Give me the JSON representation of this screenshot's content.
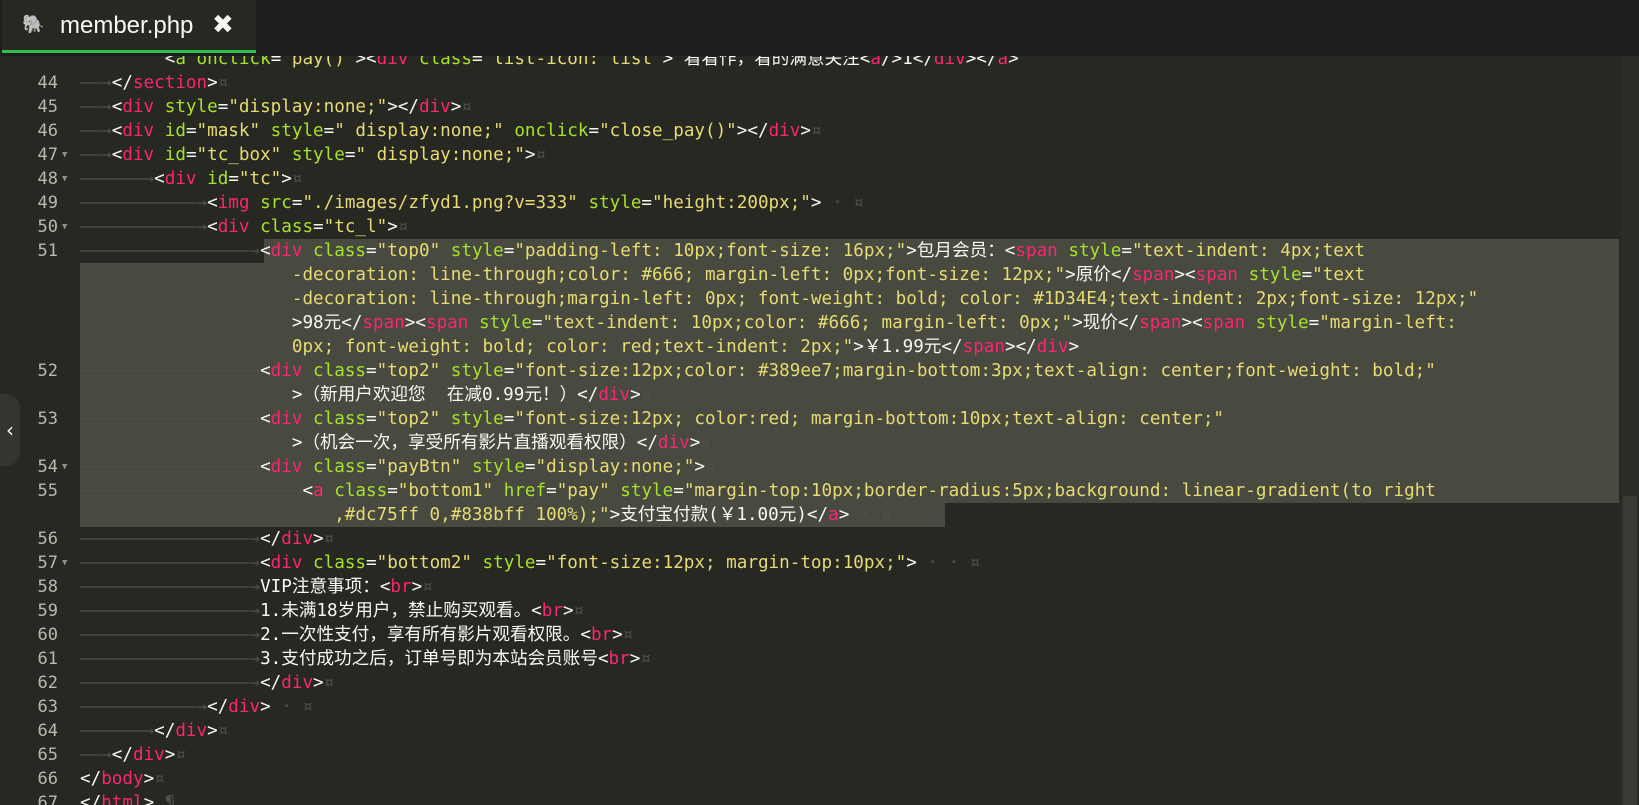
{
  "tab": {
    "title": "member.php",
    "icon": "php-elephant-icon",
    "close_glyph": "✖"
  },
  "lines": [
    {
      "no": "",
      "segs": [
        [
          "ws",
          "        "
        ],
        [
          "t",
          "<"
        ],
        [
          "a",
          "a onclick"
        ],
        [
          "t",
          "="
        ],
        [
          "s",
          "\"pay()\""
        ],
        [
          "t",
          "><"
        ],
        [
          "g",
          "div"
        ],
        [
          "a",
          " class"
        ],
        [
          "t",
          "="
        ],
        [
          "s",
          "\"list-icon: list\""
        ],
        [
          "t",
          "> 看看作，看的满意关注"
        ],
        [
          "t",
          "<"
        ],
        [
          "g",
          "a"
        ],
        [
          "t",
          "/>1"
        ],
        [
          "t",
          "</"
        ],
        [
          "g",
          "div"
        ],
        [
          "t",
          "></"
        ],
        [
          "g",
          "a"
        ],
        [
          "t",
          ">"
        ]
      ]
    },
    {
      "no": "44",
      "segs": [
        [
          "ws",
          "——→"
        ],
        [
          "t",
          "</"
        ],
        [
          "g",
          "section"
        ],
        [
          "t",
          ">"
        ],
        [
          "ws",
          "¤"
        ]
      ]
    },
    {
      "no": "45",
      "segs": [
        [
          "ws",
          "——→"
        ],
        [
          "t",
          "<"
        ],
        [
          "g",
          "div"
        ],
        [
          "a",
          " style"
        ],
        [
          "t",
          "="
        ],
        [
          "s",
          "\"display:none;\""
        ],
        [
          "t",
          "></"
        ],
        [
          "g",
          "div"
        ],
        [
          "t",
          ">"
        ],
        [
          "ws",
          "¤"
        ]
      ]
    },
    {
      "no": "46",
      "segs": [
        [
          "ws",
          "——→"
        ],
        [
          "t",
          "<"
        ],
        [
          "g",
          "div"
        ],
        [
          "a",
          " id"
        ],
        [
          "t",
          "="
        ],
        [
          "s",
          "\"mask\""
        ],
        [
          "a",
          " style"
        ],
        [
          "t",
          "="
        ],
        [
          "s",
          "\" display:none;\""
        ],
        [
          "a",
          " onclick"
        ],
        [
          "t",
          "="
        ],
        [
          "s",
          "\"close_pay()\""
        ],
        [
          "t",
          "></"
        ],
        [
          "g",
          "div"
        ],
        [
          "t",
          ">"
        ],
        [
          "ws",
          "¤"
        ]
      ]
    },
    {
      "no": "47",
      "fold": true,
      "segs": [
        [
          "ws",
          "——→"
        ],
        [
          "t",
          "<"
        ],
        [
          "g",
          "div"
        ],
        [
          "a",
          " id"
        ],
        [
          "t",
          "="
        ],
        [
          "s",
          "\"tc_box\""
        ],
        [
          "a",
          " style"
        ],
        [
          "t",
          "="
        ],
        [
          "s",
          "\" display:none;\""
        ],
        [
          "t",
          ">"
        ],
        [
          "ws",
          "¤"
        ]
      ]
    },
    {
      "no": "48",
      "fold": true,
      "segs": [
        [
          "ws",
          "——————→"
        ],
        [
          "t",
          "<"
        ],
        [
          "g",
          "div"
        ],
        [
          "a",
          " id"
        ],
        [
          "t",
          "="
        ],
        [
          "s",
          "\"tc\""
        ],
        [
          "t",
          ">"
        ],
        [
          "ws",
          "¤"
        ]
      ]
    },
    {
      "no": "49",
      "segs": [
        [
          "ws",
          "———————————→"
        ],
        [
          "t",
          "<"
        ],
        [
          "g",
          "img"
        ],
        [
          "a",
          " src"
        ],
        [
          "t",
          "="
        ],
        [
          "s",
          "\"./images/zfyd1.png?v=333\""
        ],
        [
          "a",
          " style"
        ],
        [
          "t",
          "="
        ],
        [
          "s",
          "\"height:200px;\""
        ],
        [
          "t",
          ">"
        ],
        [
          "ws",
          " · ¤"
        ]
      ]
    },
    {
      "no": "50",
      "fold": true,
      "segs": [
        [
          "ws",
          "———————————→"
        ],
        [
          "t",
          "<"
        ],
        [
          "g",
          "div"
        ],
        [
          "a",
          " class"
        ],
        [
          "t",
          "="
        ],
        [
          "s",
          "\"tc_l\""
        ],
        [
          "t",
          ">"
        ],
        [
          "ws",
          "¤"
        ]
      ]
    },
    {
      "no": "51",
      "segs": [
        [
          "ws",
          "————————————————→"
        ],
        [
          "t",
          "<"
        ],
        [
          "g",
          "div"
        ],
        [
          "a",
          " class"
        ],
        [
          "t",
          "="
        ],
        [
          "s",
          "\"top0\""
        ],
        [
          "a",
          " style"
        ],
        [
          "t",
          "="
        ],
        [
          "s",
          "\"padding-left: 10px;font-size: 16px;\""
        ],
        [
          "t",
          ">包月会员：<"
        ],
        [
          "g",
          "span"
        ],
        [
          "a",
          " style"
        ],
        [
          "t",
          "="
        ],
        [
          "s",
          "\"text-indent: 4px;text"
        ]
      ]
    },
    {
      "no": "",
      "segs": [
        [
          "ws",
          "                    "
        ],
        [
          "s",
          "-decoration: line-through;color: #666; margin-left: 0px;font-size: 12px;\""
        ],
        [
          "t",
          ">原价</"
        ],
        [
          "g",
          "span"
        ],
        [
          "t",
          "><"
        ],
        [
          "g",
          "span"
        ],
        [
          "a",
          " style"
        ],
        [
          "t",
          "="
        ],
        [
          "s",
          "\"text"
        ]
      ]
    },
    {
      "no": "",
      "segs": [
        [
          "ws",
          "                    "
        ],
        [
          "s",
          "-decoration: line-through;margin-left: 0px; font-weight: bold; color: #1D34E4;text-indent: 2px;font-size: 12px;\""
        ]
      ]
    },
    {
      "no": "",
      "segs": [
        [
          "ws",
          "                    "
        ],
        [
          "t",
          ">98元</"
        ],
        [
          "g",
          "span"
        ],
        [
          "t",
          "><"
        ],
        [
          "g",
          "span"
        ],
        [
          "a",
          " style"
        ],
        [
          "t",
          "="
        ],
        [
          "s",
          "\"text-indent: 10px;color: #666; margin-left: 0px;\""
        ],
        [
          "t",
          ">现价</"
        ],
        [
          "g",
          "span"
        ],
        [
          "t",
          "><"
        ],
        [
          "g",
          "span"
        ],
        [
          "a",
          " style"
        ],
        [
          "t",
          "="
        ],
        [
          "s",
          "\"margin-left:"
        ]
      ]
    },
    {
      "no": "",
      "segs": [
        [
          "ws",
          "                    "
        ],
        [
          "s",
          "0px; font-weight: bold; color: red;text-indent: 2px;\""
        ],
        [
          "t",
          ">￥1.99元</"
        ],
        [
          "g",
          "span"
        ],
        [
          "t",
          "></"
        ],
        [
          "g",
          "div"
        ],
        [
          "t",
          ">"
        ]
      ]
    },
    {
      "no": "52",
      "segs": [
        [
          "ws",
          "————————————————→"
        ],
        [
          "t",
          "<"
        ],
        [
          "g",
          "div"
        ],
        [
          "a",
          " class"
        ],
        [
          "t",
          "="
        ],
        [
          "s",
          "\"top2\""
        ],
        [
          "a",
          " style"
        ],
        [
          "t",
          "="
        ],
        [
          "s",
          "\"font-size:12px;color: #389ee7;margin-bottom:3px;text-align: center;font-weight: bold;\""
        ]
      ]
    },
    {
      "no": "",
      "segs": [
        [
          "ws",
          "                    "
        ],
        [
          "t",
          ">（新用户欢迎您  在减0.99元！）</"
        ],
        [
          "g",
          "div"
        ],
        [
          "t",
          ">"
        ],
        [
          "ws",
          "¤"
        ]
      ]
    },
    {
      "no": "53",
      "segs": [
        [
          "ws",
          "————————————————→"
        ],
        [
          "t",
          "<"
        ],
        [
          "g",
          "div"
        ],
        [
          "a",
          " class"
        ],
        [
          "t",
          "="
        ],
        [
          "s",
          "\"top2\""
        ],
        [
          "a",
          " style"
        ],
        [
          "t",
          "="
        ],
        [
          "s",
          "\"font-size:12px; color:red; margin-bottom:10px;text-align: center;\""
        ]
      ]
    },
    {
      "no": "",
      "segs": [
        [
          "ws",
          "                    "
        ],
        [
          "t",
          ">（机会一次，享受所有影片直播观看权限）</"
        ],
        [
          "g",
          "div"
        ],
        [
          "t",
          ">"
        ],
        [
          "ws",
          "¤"
        ]
      ]
    },
    {
      "no": "54",
      "fold": true,
      "segs": [
        [
          "ws",
          "————————————————→"
        ],
        [
          "t",
          "<"
        ],
        [
          "g",
          "div"
        ],
        [
          "a",
          " class"
        ],
        [
          "t",
          "="
        ],
        [
          "s",
          "\"payBtn\""
        ],
        [
          "a",
          " style"
        ],
        [
          "t",
          "="
        ],
        [
          "s",
          "\"display:none;\""
        ],
        [
          "t",
          ">"
        ],
        [
          "ws",
          "¤"
        ]
      ]
    },
    {
      "no": "55",
      "segs": [
        [
          "ws",
          "————————————————————→"
        ],
        [
          "t",
          "<"
        ],
        [
          "g",
          "a"
        ],
        [
          "a",
          " class"
        ],
        [
          "t",
          "="
        ],
        [
          "s",
          "\"bottom1\""
        ],
        [
          "a",
          " href"
        ],
        [
          "t",
          "="
        ],
        [
          "s",
          "\"pay\""
        ],
        [
          "a",
          " style"
        ],
        [
          "t",
          "="
        ],
        [
          "s",
          "\"margin-top:10px;border-radius:5px;background: linear-gradient(to right"
        ]
      ]
    },
    {
      "no": "",
      "segs": [
        [
          "ws",
          "                        "
        ],
        [
          "s",
          ",#dc75ff 0,#838bff 100%);\""
        ],
        [
          "t",
          ">支付宝付款(￥1.00元)</"
        ],
        [
          "g",
          "a"
        ],
        [
          "t",
          ">"
        ],
        [
          "ws",
          " · ¤"
        ]
      ]
    },
    {
      "no": "56",
      "segs": [
        [
          "ws",
          "————————————————→"
        ],
        [
          "t",
          "</"
        ],
        [
          "g",
          "div"
        ],
        [
          "t",
          ">"
        ],
        [
          "ws",
          "¤"
        ]
      ]
    },
    {
      "no": "57",
      "fold": true,
      "segs": [
        [
          "ws",
          "————————————————→"
        ],
        [
          "t",
          "<"
        ],
        [
          "g",
          "div"
        ],
        [
          "a",
          " class"
        ],
        [
          "t",
          "="
        ],
        [
          "s",
          "\"bottom2\""
        ],
        [
          "a",
          " style"
        ],
        [
          "t",
          "="
        ],
        [
          "s",
          "\"font-size:12px; margin-top:10px;\""
        ],
        [
          "t",
          ">"
        ],
        [
          "ws",
          " · · ¤"
        ]
      ]
    },
    {
      "no": "58",
      "segs": [
        [
          "ws",
          "————————————————→"
        ],
        [
          "t",
          "VIP注意事项：<"
        ],
        [
          "g",
          "br"
        ],
        [
          "t",
          ">"
        ],
        [
          "ws",
          "¤"
        ]
      ]
    },
    {
      "no": "59",
      "segs": [
        [
          "ws",
          "————————————————→"
        ],
        [
          "t",
          "1.未满18岁用户，禁止购买观看。<"
        ],
        [
          "g",
          "br"
        ],
        [
          "t",
          ">"
        ],
        [
          "ws",
          "¤"
        ]
      ]
    },
    {
      "no": "60",
      "segs": [
        [
          "ws",
          "————————————————→"
        ],
        [
          "t",
          "2.一次性支付，享有所有影片观看权限。<"
        ],
        [
          "g",
          "br"
        ],
        [
          "t",
          ">"
        ],
        [
          "ws",
          "¤"
        ]
      ]
    },
    {
      "no": "61",
      "segs": [
        [
          "ws",
          "————————————————→"
        ],
        [
          "t",
          "3.支付成功之后，订单号即为本站会员账号<"
        ],
        [
          "g",
          "br"
        ],
        [
          "t",
          ">"
        ],
        [
          "ws",
          "¤"
        ]
      ]
    },
    {
      "no": "62",
      "segs": [
        [
          "ws",
          "————————————————→"
        ],
        [
          "t",
          "</"
        ],
        [
          "g",
          "div"
        ],
        [
          "t",
          ">"
        ],
        [
          "ws",
          "¤"
        ]
      ]
    },
    {
      "no": "63",
      "segs": [
        [
          "ws",
          "———————————→"
        ],
        [
          "t",
          "</"
        ],
        [
          "g",
          "div"
        ],
        [
          "t",
          ">"
        ],
        [
          "ws",
          " · ¤"
        ]
      ]
    },
    {
      "no": "64",
      "segs": [
        [
          "ws",
          "——————→"
        ],
        [
          "t",
          "</"
        ],
        [
          "g",
          "div"
        ],
        [
          "t",
          ">"
        ],
        [
          "ws",
          "¤"
        ]
      ]
    },
    {
      "no": "65",
      "segs": [
        [
          "ws",
          "——→"
        ],
        [
          "t",
          "</"
        ],
        [
          "g",
          "div"
        ],
        [
          "t",
          ">"
        ],
        [
          "ws",
          "¤"
        ]
      ]
    },
    {
      "no": "66",
      "segs": [
        [
          "t",
          "</"
        ],
        [
          "g",
          "body"
        ],
        [
          "t",
          ">"
        ],
        [
          "ws",
          "¤"
        ]
      ]
    },
    {
      "no": "67",
      "segs": [
        [
          "t",
          "</"
        ],
        [
          "g",
          "html"
        ],
        [
          "t",
          ">"
        ],
        [
          "ws",
          " ¶"
        ]
      ]
    }
  ],
  "side_handle_glyph": "‹"
}
